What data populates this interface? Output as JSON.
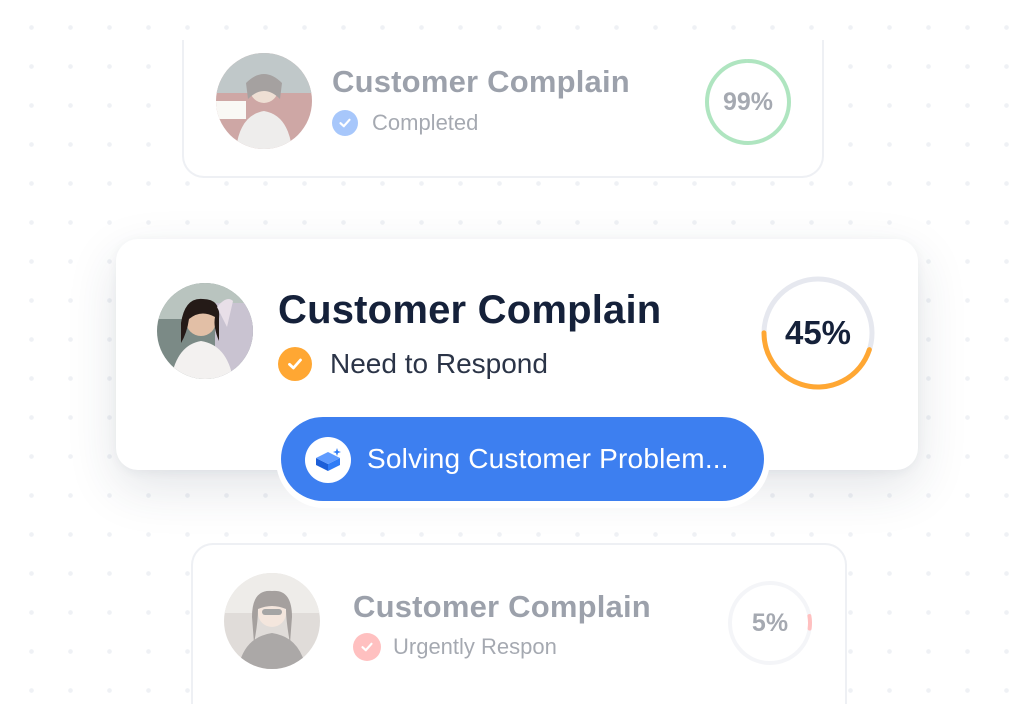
{
  "cards": [
    {
      "title": "Customer Complain",
      "status": "Completed",
      "status_color": "#2f7cf6",
      "progress_label": "99%",
      "progress_value": 99,
      "ring_color": "#43c26b"
    },
    {
      "title": "Customer Complain",
      "status": "Need to Respond",
      "status_color": "#ffa733",
      "progress_label": "45%",
      "progress_value": 45,
      "ring_color": "#ffa733"
    },
    {
      "title": "Customer Complain",
      "status": "Urgently Respon",
      "status_color": "#ff6b6b",
      "progress_label": "5%",
      "progress_value": 5,
      "ring_color": "#ff6b6b"
    }
  ],
  "action_pill": {
    "label": "Solving Customer Problem...",
    "color": "#3d7ff0"
  },
  "colors": {
    "title_dark": "#15213a",
    "text_dark": "#2b3447",
    "ring_track": "#e6e8ef"
  }
}
